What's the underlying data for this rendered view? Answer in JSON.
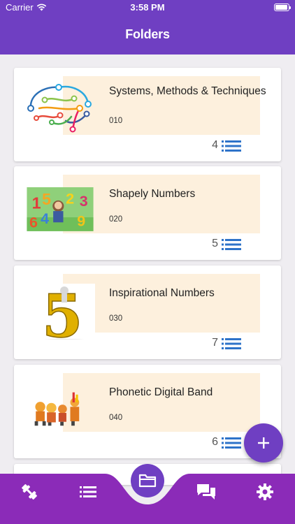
{
  "status": {
    "carrier": "Carrier",
    "time": "3:58 PM"
  },
  "header": {
    "title": "Folders"
  },
  "folders": [
    {
      "name": "Systems, Methods & Techniques",
      "code": "010",
      "count": "4",
      "image": "brain-network-illustration"
    },
    {
      "name": "Shapely Numbers",
      "code": "020",
      "count": "5",
      "image": "cartoon-numbers-illustration"
    },
    {
      "name": "Inspirational Numbers",
      "code": "030",
      "count": "7",
      "image": "golden-five-illustration"
    },
    {
      "name": "Phonetic Digital Band",
      "code": "040",
      "count": "6",
      "image": "cartoon-band-illustration"
    }
  ],
  "fab": {
    "icon": "plus-icon"
  },
  "tabbar": {
    "items": [
      "dumbbell-icon",
      "list-icon",
      "folder-icon",
      "chat-icon",
      "gear-icon"
    ],
    "active": "folder-icon"
  },
  "colors": {
    "primary": "#6f3fc2",
    "tabbar": "#8b2bb8",
    "panel": "#fdf0dd",
    "accent_blue": "#2e73c9"
  }
}
